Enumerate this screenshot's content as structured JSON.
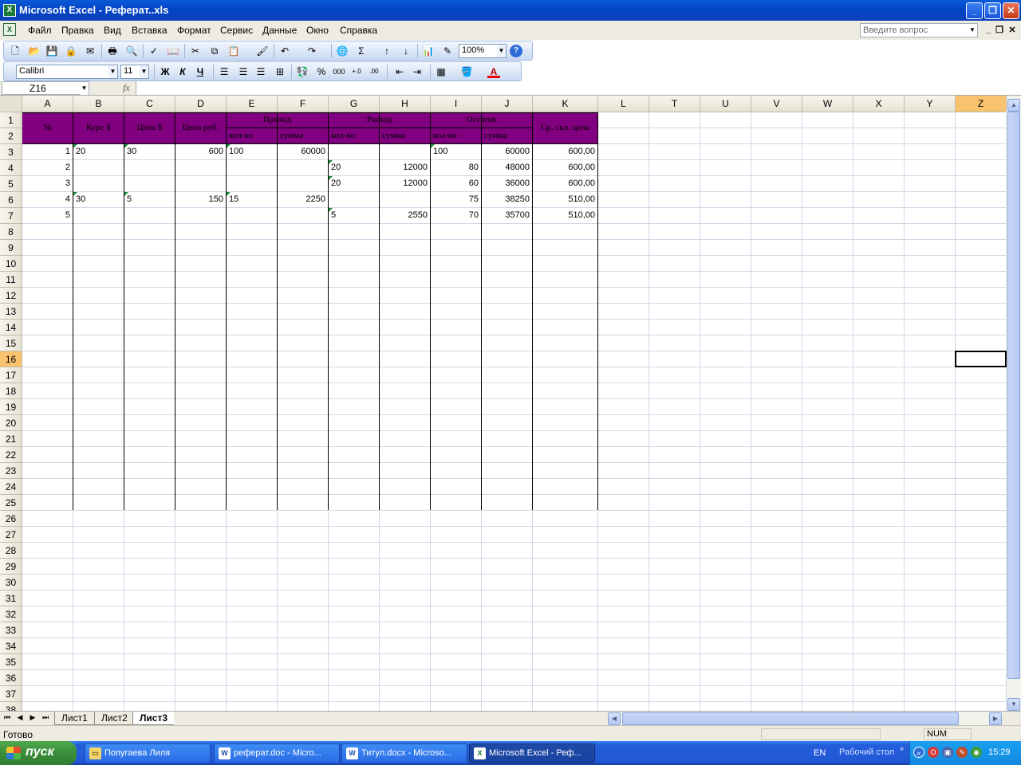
{
  "window": {
    "title": "Microsoft Excel - Реферат..xls"
  },
  "menu": {
    "items": [
      "Файл",
      "Правка",
      "Вид",
      "Вставка",
      "Формат",
      "Сервис",
      "Данные",
      "Окно",
      "Справка"
    ],
    "help_placeholder": "Введите вопрос"
  },
  "toolbar": {
    "zoom": "100%",
    "font": "Calibri",
    "size": "11",
    "bold": "Ж",
    "italic": "К",
    "underline": "Ч"
  },
  "formula_bar": {
    "name_box": "Z16",
    "fx": "fx",
    "content": ""
  },
  "columns": [
    "A",
    "B",
    "C",
    "D",
    "E",
    "F",
    "G",
    "H",
    "I",
    "J",
    "K",
    "L",
    "T",
    "U",
    "V",
    "W",
    "X",
    "Y",
    "Z"
  ],
  "selected": {
    "column": "Z",
    "row": "16"
  },
  "table": {
    "headers": {
      "num": "№",
      "kurs": "Курс $",
      "price_usd": "Цена $",
      "price_rub": "Цена руб.",
      "prihod": "Приход",
      "rashod": "Расход",
      "ostatok": "Остаток",
      "avg_price": "Ср. скл. цена",
      "qty": "кол-во",
      "sum": "сумма"
    },
    "rows": [
      [
        "1",
        "20",
        "30",
        "600",
        "100",
        "60000",
        "",
        "",
        "100",
        "60000",
        "600,00"
      ],
      [
        "2",
        "",
        "",
        "",
        "",
        "",
        "20",
        "12000",
        "80",
        "48000",
        "600,00"
      ],
      [
        "3",
        "",
        "",
        "",
        "",
        "",
        "20",
        "12000",
        "60",
        "36000",
        "600,00"
      ],
      [
        "4",
        "30",
        "5",
        "150",
        "15",
        "2250",
        "",
        "",
        "75",
        "38250",
        "510,00"
      ],
      [
        "5",
        "",
        "",
        "",
        "",
        "",
        "5",
        "2550",
        "70",
        "35700",
        "510,00"
      ]
    ]
  },
  "sheets": {
    "tabs": [
      "Лист1",
      "Лист2",
      "Лист3"
    ],
    "active": "Лист3"
  },
  "status": {
    "text": "Готово",
    "num": "NUM"
  },
  "taskbar": {
    "start": "пуск",
    "tasks": [
      "Попугаева Лиля",
      "реферат.doc - Micro...",
      "Титул.docx - Microso...",
      "Microsoft Excel - Реф..."
    ],
    "lang": "EN",
    "desktop": "Рабочий стол",
    "clock": "15:29"
  }
}
